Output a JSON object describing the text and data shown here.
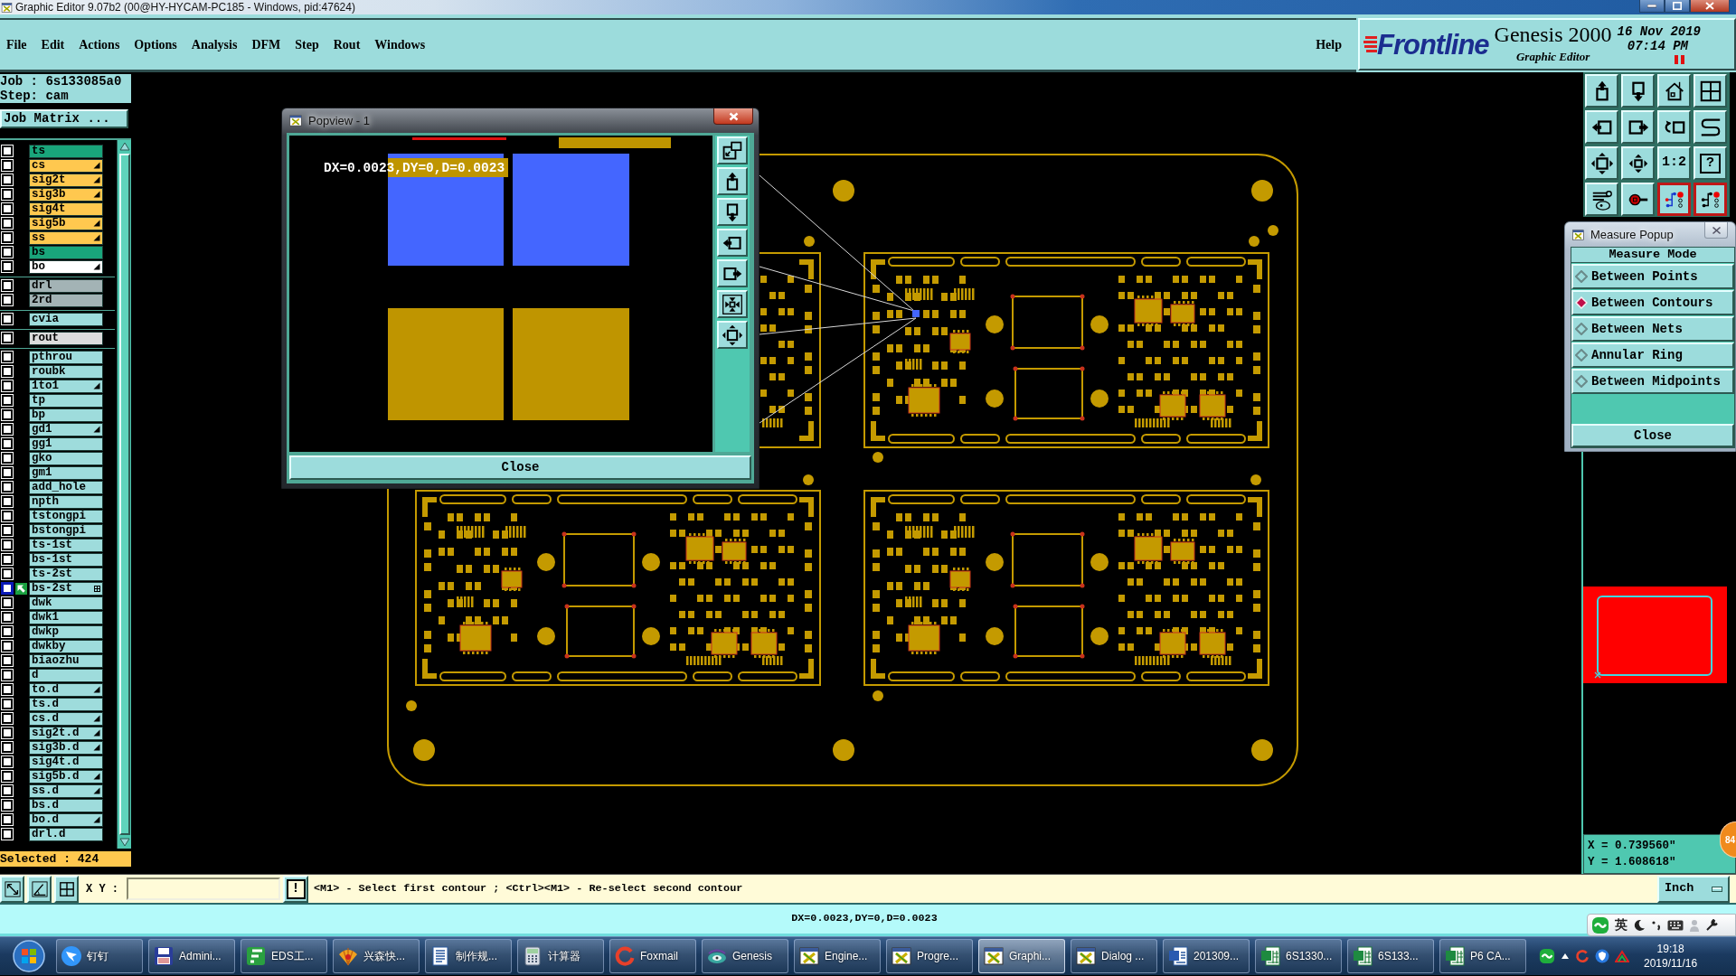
{
  "window": {
    "title": "Graphic Editor 9.07b2 (00@HY-HYCAM-PC185 - Windows, pid:47624)"
  },
  "menu": {
    "items": [
      "File",
      "Edit",
      "Actions",
      "Options",
      "Analysis",
      "DFM",
      "Step",
      "Rout",
      "Windows"
    ],
    "help": "Help"
  },
  "header": {
    "logo": "Frontline",
    "product": "Genesis 2000",
    "subtitle": "Graphic Editor",
    "date": "16 Nov 2019",
    "time": "07:14 PM"
  },
  "job_panel": {
    "job": "Job : 6s133085a0",
    "step": "Step: cam",
    "matrix_button": "Job Matrix ...",
    "layer_groups": [
      {
        "layers": [
          {
            "name": "ts",
            "color": "#19a57b",
            "checked": false,
            "marked": false,
            "work_layer": false
          },
          {
            "name": "cs",
            "color": "#ffc84f",
            "checked": false,
            "marked": true,
            "work_layer": false
          },
          {
            "name": "sig2t",
            "color": "#ffc84f",
            "checked": false,
            "marked": true,
            "work_layer": false
          },
          {
            "name": "sig3b",
            "color": "#ffc84f",
            "checked": false,
            "marked": true,
            "work_layer": false
          },
          {
            "name": "sig4t",
            "color": "#ffc84f",
            "checked": false,
            "marked": false,
            "work_layer": false
          },
          {
            "name": "sig5b",
            "color": "#ffc84f",
            "checked": false,
            "marked": true,
            "work_layer": false
          },
          {
            "name": "ss",
            "color": "#ffc84f",
            "checked": false,
            "marked": true,
            "work_layer": false
          },
          {
            "name": "bs",
            "color": "#19a57b",
            "checked": false,
            "marked": false,
            "work_layer": false
          },
          {
            "name": "bo",
            "color": "#ffffff",
            "checked": false,
            "marked": true,
            "work_layer": false
          }
        ]
      },
      {
        "layers": [
          {
            "name": "drl",
            "color": "#a3b3b5",
            "checked": false,
            "marked": false,
            "work_layer": false
          },
          {
            "name": "2rd",
            "color": "#a3b3b5",
            "checked": false,
            "marked": false,
            "work_layer": false
          }
        ]
      },
      {
        "layers": [
          {
            "name": "cvia",
            "color": "#9edcdc",
            "checked": false,
            "marked": false,
            "work_layer": false
          }
        ]
      },
      {
        "layers": [
          {
            "name": "rout",
            "color": "#dcdcdc",
            "checked": false,
            "marked": false,
            "work_layer": false
          }
        ]
      },
      {
        "layers": [
          {
            "name": "pthrou",
            "color": "#9edcdc",
            "checked": false,
            "marked": false,
            "work_layer": false
          },
          {
            "name": "roubk",
            "color": "#9edcdc",
            "checked": false,
            "marked": false,
            "work_layer": false
          },
          {
            "name": "1to1",
            "color": "#9edcdc",
            "checked": false,
            "marked": true,
            "work_layer": false
          },
          {
            "name": "tp",
            "color": "#9edcdc",
            "checked": false,
            "marked": false,
            "work_layer": false
          },
          {
            "name": "bp",
            "color": "#9edcdc",
            "checked": false,
            "marked": false,
            "work_layer": false
          },
          {
            "name": "gd1",
            "color": "#9edcdc",
            "checked": false,
            "marked": true,
            "work_layer": false
          },
          {
            "name": "gg1",
            "color": "#9edcdc",
            "checked": false,
            "marked": false,
            "work_layer": false
          },
          {
            "name": "gko",
            "color": "#9edcdc",
            "checked": false,
            "marked": false,
            "work_layer": false
          },
          {
            "name": "gm1",
            "color": "#9edcdc",
            "checked": false,
            "marked": false,
            "work_layer": false
          },
          {
            "name": "add_hole",
            "color": "#9edcdc",
            "checked": false,
            "marked": false,
            "work_layer": false
          },
          {
            "name": "npth",
            "color": "#9edcdc",
            "checked": false,
            "marked": false,
            "work_layer": false
          },
          {
            "name": "tstongpi",
            "color": "#9edcdc",
            "checked": false,
            "marked": false,
            "work_layer": false
          },
          {
            "name": "bstongpi",
            "color": "#9edcdc",
            "checked": false,
            "marked": false,
            "work_layer": false
          },
          {
            "name": "ts-1st",
            "color": "#9edcdc",
            "checked": false,
            "marked": false,
            "work_layer": false
          },
          {
            "name": "bs-1st",
            "color": "#9edcdc",
            "checked": false,
            "marked": false,
            "work_layer": false
          },
          {
            "name": "ts-2st",
            "color": "#9edcdc",
            "checked": false,
            "marked": false,
            "work_layer": false
          },
          {
            "name": "bs-2st",
            "color": "#9edcdc",
            "checked": false,
            "marked": false,
            "work_layer": true
          },
          {
            "name": "dwk",
            "color": "#9edcdc",
            "checked": false,
            "marked": false,
            "work_layer": false
          },
          {
            "name": "dwk1",
            "color": "#9edcdc",
            "checked": false,
            "marked": false,
            "work_layer": false
          },
          {
            "name": "dwkp",
            "color": "#9edcdc",
            "checked": false,
            "marked": false,
            "work_layer": false
          },
          {
            "name": "dwkby",
            "color": "#9edcdc",
            "checked": false,
            "marked": false,
            "work_layer": false
          },
          {
            "name": "biaozhu",
            "color": "#9edcdc",
            "checked": false,
            "marked": false,
            "work_layer": false
          },
          {
            "name": "d",
            "color": "#9edcdc",
            "checked": false,
            "marked": false,
            "work_layer": false
          },
          {
            "name": "to.d",
            "color": "#9edcdc",
            "checked": false,
            "marked": true,
            "work_layer": false
          },
          {
            "name": "ts.d",
            "color": "#9edcdc",
            "checked": false,
            "marked": false,
            "work_layer": false
          },
          {
            "name": "cs.d",
            "color": "#9edcdc",
            "checked": false,
            "marked": true,
            "work_layer": false
          },
          {
            "name": "sig2t.d",
            "color": "#9edcdc",
            "checked": false,
            "marked": true,
            "work_layer": false
          },
          {
            "name": "sig3b.d",
            "color": "#9edcdc",
            "checked": false,
            "marked": true,
            "work_layer": false
          },
          {
            "name": "sig4t.d",
            "color": "#9edcdc",
            "checked": false,
            "marked": false,
            "work_layer": false
          },
          {
            "name": "sig5b.d",
            "color": "#9edcdc",
            "checked": false,
            "marked": true,
            "work_layer": false
          },
          {
            "name": "ss.d",
            "color": "#9edcdc",
            "checked": false,
            "marked": true,
            "work_layer": false
          },
          {
            "name": "bs.d",
            "color": "#9edcdc",
            "checked": false,
            "marked": false,
            "work_layer": false
          },
          {
            "name": "bo.d",
            "color": "#9edcdc",
            "checked": false,
            "marked": true,
            "work_layer": false
          },
          {
            "name": "drl.d",
            "color": "#9edcdc",
            "checked": false,
            "marked": false,
            "work_layer": false
          }
        ]
      }
    ],
    "selected_count": "Selected : 424"
  },
  "popview": {
    "title": "Popview - 1",
    "measurement": "DX=0.0023,DY=0,D=0.0023",
    "close": "Close"
  },
  "toolbar": [
    {
      "on": false
    },
    {
      "on": false
    },
    {
      "on": false
    },
    {
      "on": false
    },
    {
      "on": false
    },
    {
      "on": false
    },
    {
      "on": false
    },
    {
      "on": false
    },
    {
      "on": false
    },
    {
      "on": false
    },
    {
      "label": "1:2",
      "on": false
    },
    {
      "label": "?",
      "on": false
    },
    {
      "on": false
    },
    {
      "on": false
    },
    {
      "on": true
    },
    {
      "on": true
    }
  ],
  "measure_popup": {
    "title": "Measure Popup",
    "heading": "Measure Mode",
    "options": [
      {
        "label": "Between Points",
        "selected": false
      },
      {
        "label": "Between Contours",
        "selected": true
      },
      {
        "label": "Between Nets",
        "selected": false
      },
      {
        "label": "Annular Ring",
        "selected": false
      },
      {
        "label": "Between Midpoints",
        "selected": false
      }
    ],
    "close": "Close"
  },
  "coordinates": {
    "x": "X = 0.739560\"",
    "y": "Y = 1.608618\""
  },
  "floating_badge": "84",
  "command_bar": {
    "label": "X Y :",
    "message_button": "!",
    "prompt": "<M1> - Select first contour ; <Ctrl><M1> - Re-select second contour",
    "unit": "Inch"
  },
  "status_bar": {
    "text": "DX=0.0023,DY=0,D=0.0023"
  },
  "ime_bar": {
    "mode": "英"
  },
  "taskbar": {
    "items": [
      {
        "label": "钉钉",
        "selected": false
      },
      {
        "label": "Admini...",
        "selected": false
      },
      {
        "label": "EDS工...",
        "selected": false
      },
      {
        "label": "兴森快...",
        "selected": false
      },
      {
        "label": "制作规...",
        "selected": false
      },
      {
        "label": "计算器",
        "selected": false
      },
      {
        "label": "Foxmail",
        "selected": false
      },
      {
        "label": "Genesis",
        "selected": false
      },
      {
        "label": "Engine...",
        "selected": false
      },
      {
        "label": "Progre...",
        "selected": false
      },
      {
        "label": "Graphi...",
        "selected": true
      },
      {
        "label": "Dialog ...",
        "selected": false
      },
      {
        "label": "201309...",
        "selected": false
      },
      {
        "label": "6S1330...",
        "selected": false
      },
      {
        "label": "6S133...",
        "selected": false
      },
      {
        "label": "P6 CA...",
        "selected": false
      }
    ],
    "clock": {
      "time": "19:18",
      "date": "2019/11/16"
    }
  }
}
